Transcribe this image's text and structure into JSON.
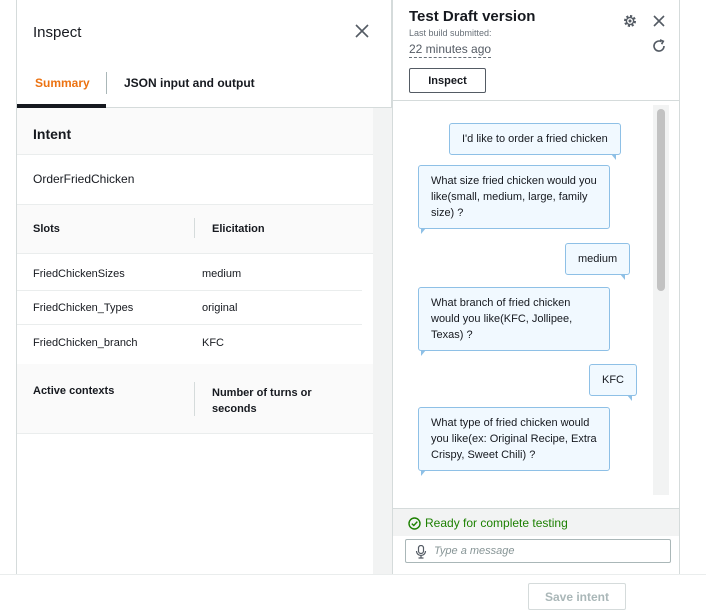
{
  "inspect": {
    "title": "Inspect",
    "tabs": [
      {
        "label": "Summary",
        "active": true
      },
      {
        "label": "JSON input and output",
        "active": false
      }
    ],
    "intent_heading": "Intent",
    "intent_value": "OrderFriedChicken",
    "slots_table": {
      "headers": [
        "Slots",
        "Elicitation"
      ],
      "rows": [
        {
          "slot": "FriedChickenSizes",
          "value": "medium"
        },
        {
          "slot": "FriedChicken_Types",
          "value": "original"
        },
        {
          "slot": "FriedChicken_branch",
          "value": "KFC"
        }
      ]
    },
    "contexts_table": {
      "headers": [
        "Active contexts",
        "Number of turns or seconds"
      ]
    }
  },
  "test": {
    "title": "Test Draft version",
    "build_label": "Last build submitted:",
    "build_time": "22 minutes ago",
    "inspect_button": "Inspect",
    "messages": [
      {
        "from": "user",
        "text": "I'd like to order a fried chicken"
      },
      {
        "from": "bot",
        "text": "What size fried chicken would you like(small, medium, large, family size) ?"
      },
      {
        "from": "user",
        "text": "medium"
      },
      {
        "from": "bot",
        "text": "What branch of fried chicken would you like(KFC, Jollipee, Texas) ?"
      },
      {
        "from": "user",
        "text": "KFC"
      },
      {
        "from": "bot",
        "text": "What type of fried chicken would you like(ex: Original Recipe, Extra Crispy, Sweet Chili) ?"
      }
    ],
    "status": "Ready for complete testing",
    "input_placeholder": "Type a message"
  },
  "footer": {
    "save_label": "Save intent"
  },
  "colors": {
    "accent_orange": "#ec7211",
    "success_green": "#1d8102",
    "bubble_fill": "#f1f9ff",
    "bubble_border": "#8ec0e6"
  },
  "icons": [
    "close-icon",
    "gear-icon",
    "refresh-icon",
    "check-circle-icon",
    "microphone-icon"
  ]
}
